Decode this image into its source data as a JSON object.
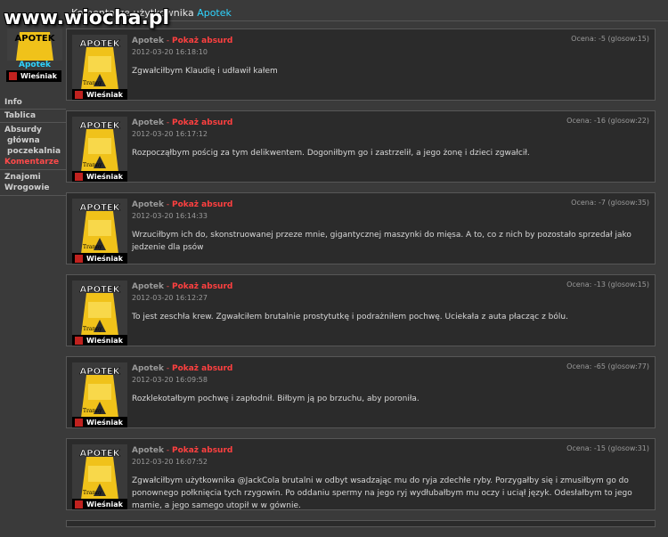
{
  "watermark": "www.wiocha.pl",
  "header": {
    "title": "Komentarze użytkownika",
    "user": "Apotek"
  },
  "profile": {
    "name": "Apotek",
    "rank": "Wieśniak"
  },
  "nav": {
    "info": "Info",
    "tablica": "Tablica",
    "absurdy": "Absurdy",
    "glowna": "główna",
    "poczekalnia": "poczekalnia",
    "komentarze": "Komentarze",
    "znajomi": "Znajomi",
    "wrogowie": "Wrogowie"
  },
  "comments": [
    {
      "author": "Apotek",
      "sep": "-",
      "action": "Pokaż absurd",
      "date": "2012-03-20 16:18:10",
      "score": "Ocena: -5 (glosow:15)",
      "rank": "Wieśniak",
      "text": "Zgwałciłbym Klaudię i udławił kałem"
    },
    {
      "author": "Apotek",
      "sep": "-",
      "action": "Pokaż absurd",
      "date": "2012-03-20 16:17:12",
      "score": "Ocena: -16 (glosow:22)",
      "rank": "Wieśniak",
      "text": "Rozpocząłbym pościg za tym delikwentem. Dogoniłbym go i zastrzelił, a jego żonę i dzieci zgwałcił."
    },
    {
      "author": "Apotek",
      "sep": "-",
      "action": "Pokaż absurd",
      "date": "2012-03-20 16:14:33",
      "score": "Ocena: -7 (glosow:35)",
      "rank": "Wieśniak",
      "text": "Wrzuciłbym ich do, skonstruowanej przeze mnie, gigantycznej maszynki do mięsa. A to, co z nich by pozostało sprzedał jako jedzenie dla psów"
    },
    {
      "author": "Apotek",
      "sep": "-",
      "action": "Pokaż absurd",
      "date": "2012-03-20 16:12:27",
      "score": "Ocena: -13 (glosow:15)",
      "rank": "Wieśniak",
      "text": "To jest zeschła krew. Zgwałciłem brutalnie prostytutkę i podrażniłem pochwę. Uciekała z auta płacząc z bólu."
    },
    {
      "author": "Apotek",
      "sep": "-",
      "action": "Pokaż absurd",
      "date": "2012-03-20 16:09:58",
      "score": "Ocena: -65 (glosow:77)",
      "rank": "Wieśniak",
      "text": "Rozklekotałbym pochwę i zapłodnił. Biłbym ją po brzuchu, aby poroniła."
    },
    {
      "author": "Apotek",
      "sep": "-",
      "action": "Pokaż absurd",
      "date": "2012-03-20 16:07:52",
      "score": "Ocena: -15 (glosow:31)",
      "rank": "Wieśniak",
      "text": "Zgwałciłbym użytkownika @JackCola brutalni w odbyt wsadzając mu do ryja zdechłe ryby. Porzygałby się i zmusiłbym go do ponownego połknięcia tych rzygowin. Po oddaniu spermy na jego ryj wydłubałbym mu oczy i uciął język. Odesłałbym to jego mamie, a jego samego utopił w w gównie."
    }
  ],
  "colors": {
    "accent_user": "#2fd4ff",
    "absurd_link": "#ff4040",
    "card_bg": "#2b2b2b",
    "page_bg": "#3a3a3a"
  }
}
